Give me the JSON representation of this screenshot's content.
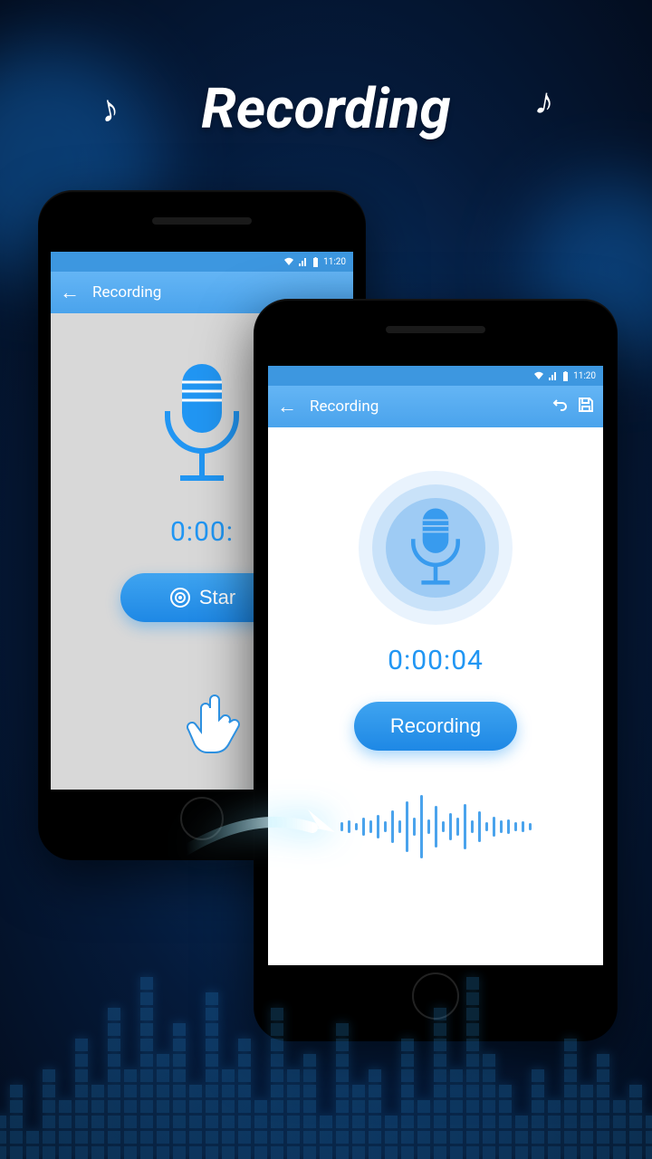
{
  "page_title": "Recording",
  "icons": {
    "note": "♪"
  },
  "phone1": {
    "statusbar": {
      "time": "11:20"
    },
    "appbar": {
      "title": "Recording"
    },
    "timer": "0:00:",
    "button_label": "Star"
  },
  "phone2": {
    "statusbar": {
      "time": "11:20"
    },
    "appbar": {
      "title": "Recording"
    },
    "timer": "0:00:04",
    "button_label": "Recording"
  },
  "waveform_heights": [
    10,
    14,
    8,
    20,
    14,
    26,
    12,
    36,
    14,
    56,
    20,
    70,
    16,
    46,
    12,
    30,
    20,
    50,
    14,
    34,
    10,
    22,
    14,
    16,
    10,
    12,
    8
  ]
}
